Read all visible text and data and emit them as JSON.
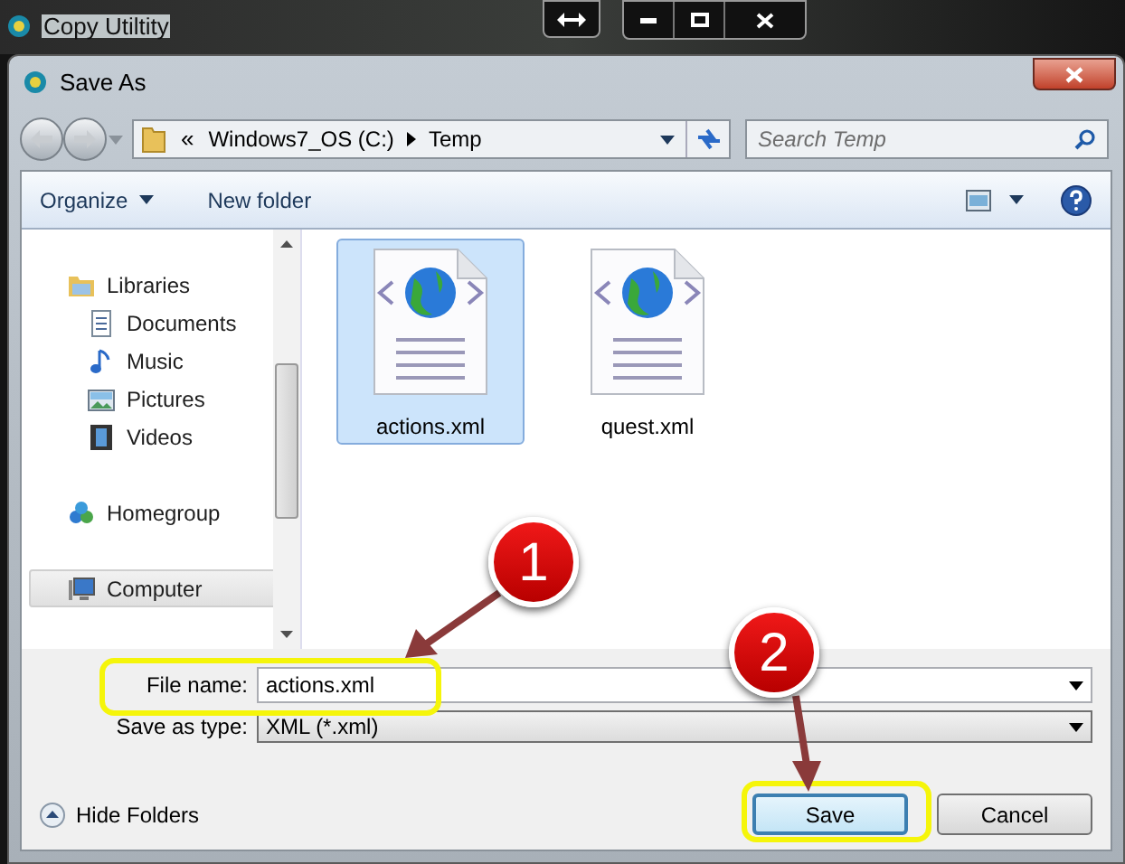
{
  "background_window": {
    "title": "Copy Utiltity"
  },
  "dialog": {
    "title": "Save As"
  },
  "address": {
    "overflow": "«",
    "segments": [
      "Windows7_OS (C:)",
      "Temp"
    ]
  },
  "search": {
    "placeholder": "Search Temp"
  },
  "toolbar": {
    "organize": "Organize",
    "new_folder": "New folder"
  },
  "sidebar": {
    "items": [
      {
        "label": "Libraries",
        "kind": "libraries",
        "selected": false,
        "children": [
          {
            "label": "Documents",
            "kind": "documents",
            "selected": false
          },
          {
            "label": "Music",
            "kind": "music",
            "selected": false
          },
          {
            "label": "Pictures",
            "kind": "pictures",
            "selected": false
          },
          {
            "label": "Videos",
            "kind": "videos",
            "selected": false
          }
        ]
      },
      {
        "label": "Homegroup",
        "kind": "homegroup",
        "selected": false
      },
      {
        "label": "Computer",
        "kind": "computer",
        "selected": true
      }
    ]
  },
  "files": [
    {
      "name": "actions.xml",
      "selected": true
    },
    {
      "name": "quest.xml",
      "selected": false
    }
  ],
  "file_name": {
    "label": "File name:",
    "value": "actions.xml"
  },
  "save_as_type": {
    "label": "Save as type:",
    "value": "XML (*.xml)"
  },
  "hide_folders": "Hide Folders",
  "buttons": [
    {
      "label": "Save",
      "kind": "default"
    },
    {
      "label": "Cancel",
      "kind": "normal"
    }
  ],
  "annotations": [
    {
      "number": "1"
    },
    {
      "number": "2"
    }
  ]
}
